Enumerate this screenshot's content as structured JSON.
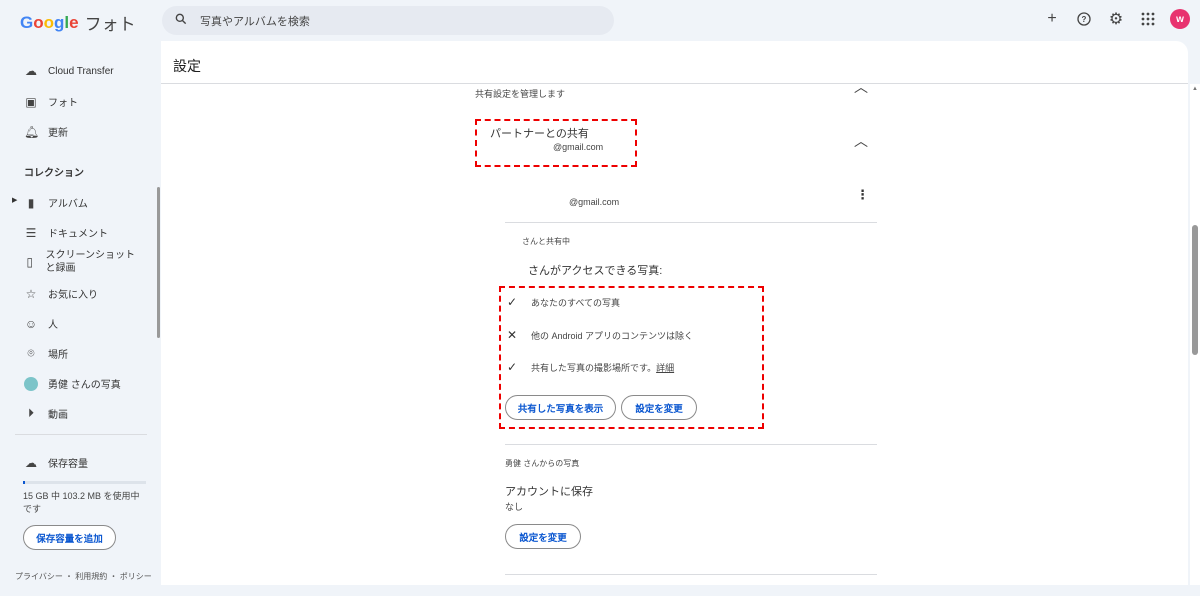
{
  "app": {
    "logo_google": "Google",
    "logo_product": "フォト",
    "search_placeholder": "写真やアルバムを検索",
    "avatar_letter": "w"
  },
  "sidebar": {
    "items": [
      {
        "label": "Cloud Transfer",
        "icon": "cloud-transfer-icon"
      },
      {
        "label": "フォト",
        "icon": "photo-icon"
      },
      {
        "label": "更新",
        "icon": "bell-icon"
      }
    ],
    "section": "コレクション",
    "collection": [
      {
        "label": "アルバム"
      },
      {
        "label": "ドキュメント"
      },
      {
        "label": "スクリーンショットと録画"
      },
      {
        "label": "お気に入り"
      },
      {
        "label": "人"
      },
      {
        "label": "場所"
      },
      {
        "label": "勇健 さんの写真"
      },
      {
        "label": "動画"
      }
    ],
    "storage": {
      "label": "保存容量",
      "usage": "15 GB 中 103.2 MB を使用中です",
      "used_fraction": 0.007,
      "button": "保存容量を追加"
    },
    "footer": "プライバシー ・ 利用規約 ・ ポリシー"
  },
  "main": {
    "title": "設定",
    "manage_sharing": "共有設定を管理します",
    "partner_title": "パートナーとの共有",
    "partner_email": "@gmail.com",
    "partner_account_email": "@gmail.com",
    "sharing_with": "さんと共有中",
    "access_title": "さんがアクセスできる写真:",
    "access_items": [
      {
        "icon": "check",
        "text": "あなたのすべての写真"
      },
      {
        "icon": "x",
        "text": "他の Android アプリのコンテンツは除く"
      },
      {
        "icon": "check",
        "text": "共有した写真の撮影場所です。",
        "link": "詳細"
      }
    ],
    "view_shared_button": "共有した写真を表示",
    "change_settings_button": "設定を変更",
    "from_partner": "勇健 さんからの写真",
    "save_to_account": "アカウントに保存",
    "save_value": "なし",
    "change_settings_button2": "設定を変更"
  }
}
